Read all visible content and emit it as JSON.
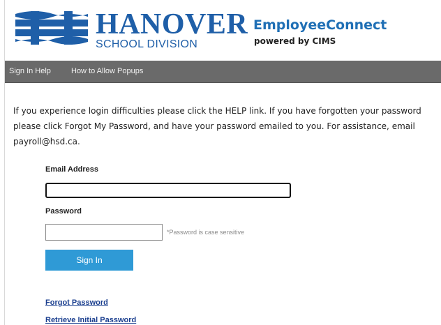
{
  "header": {
    "brand_name": "HANOVER",
    "brand_sub": "SCHOOL DIVISION",
    "app_title": "EmployeeConnect",
    "app_subtitle": "powered by CIMS"
  },
  "nav": {
    "items": [
      {
        "label": "Sign In Help"
      },
      {
        "label": "How to Allow Popups"
      }
    ]
  },
  "intro": {
    "line1": "If you experience login difficulties please click the HELP link. If you have forgotten your password",
    "line2": "please click Forgot My Password, and have your password emailed to you. For assistance, email",
    "line3": "payroll@hsd.ca."
  },
  "form": {
    "email_label": "Email Address",
    "email_value": "",
    "password_label": "Password",
    "password_value": "",
    "password_hint": "*Password is case sensitive",
    "submit_label": "Sign In"
  },
  "links": {
    "forgot_password": "Forgot Password",
    "retrieve_initial_password": "Retrieve Initial Password"
  },
  "colors": {
    "brand_blue": "#1f5fa8",
    "nav_gray": "#6a6a6a",
    "button_blue": "#2f9ad6",
    "link_blue": "#1b3f8f"
  }
}
